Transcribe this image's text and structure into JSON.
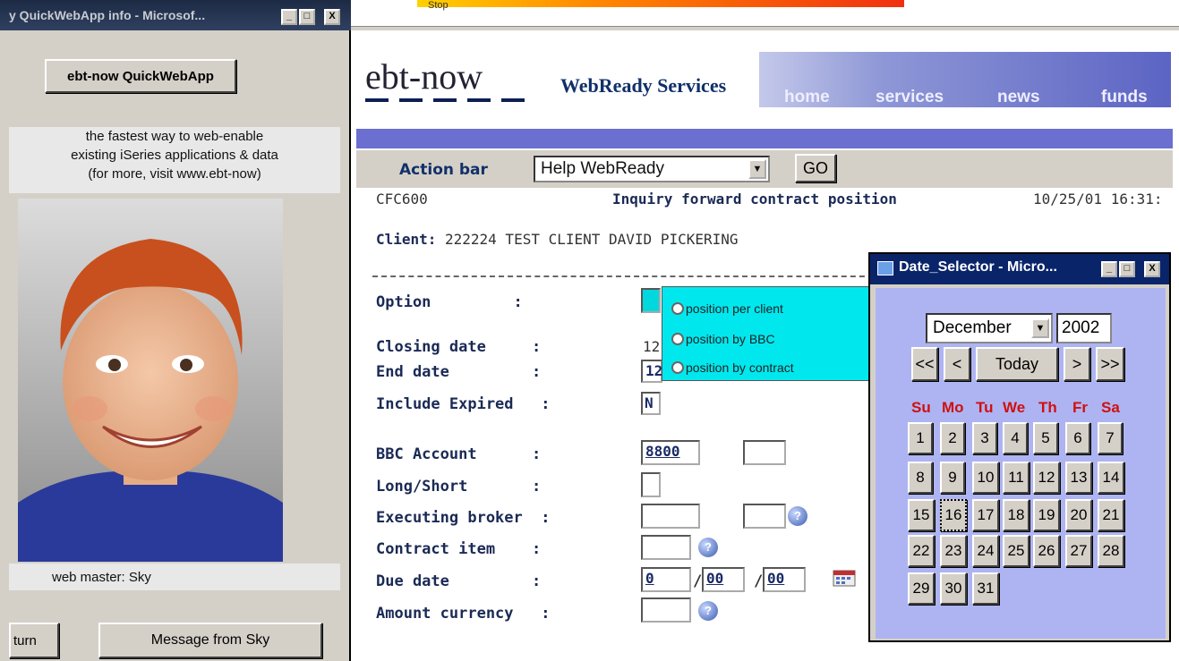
{
  "left_window": {
    "title": "y QuickWebApp info - Microsof...",
    "min": "_",
    "max": "□",
    "close": "X",
    "app_button": "ebt-now QuickWebApp",
    "description": [
      "the fastest way to web-enable",
      "existing iSeries applications & data",
      "(for more, visit www.ebt-now)"
    ],
    "webmaster": "web master: Sky",
    "return_button": "turn",
    "message_button": "Message from Sky"
  },
  "top_strip": {
    "stop": "Stop"
  },
  "header": {
    "logo": "ebt-now",
    "tagline": "WebReady Services",
    "nav": [
      "home",
      "services",
      "news",
      "funds"
    ]
  },
  "action_bar": {
    "label": "Action bar",
    "selected": "Help WebReady",
    "go": "GO"
  },
  "screen": {
    "program": "CFC600",
    "title": "Inquiry forward contract position",
    "datetime": "10/25/01 16:31:",
    "client_label": "Client:",
    "client_value": "222224 TEST CLIENT DAVID PICKERING"
  },
  "fields": {
    "option": "Option         :",
    "closing_date": "Closing date     :",
    "closing_value": "12",
    "end_date": "End date         :",
    "end_value": "12",
    "include_expired": "Include Expired   :",
    "include_value": "N",
    "bbc_account": "BBC Account      :",
    "bbc_value": "8800",
    "long_short": "Long/Short       :",
    "executing_broker": "Executing broker  :",
    "contract_item": "Contract item    :",
    "due_date": "Due date         :",
    "due_d": "0",
    "due_sep1": "/",
    "due_m": "00",
    "due_sep2": "/",
    "due_y": "00",
    "amount_currency": "Amount currency   :"
  },
  "option_popup": [
    "position per client",
    "position by BBC",
    "position by contract"
  ],
  "date_selector": {
    "title": "Date_Selector - Micro...",
    "min": "_",
    "max": "□",
    "close": "X",
    "month": "December",
    "year": "2002",
    "nav": [
      "<<",
      "<",
      "Today",
      ">",
      ">>"
    ],
    "weekdays": [
      "Su",
      "Mo",
      "Tu",
      "We",
      "Th",
      "Fr",
      "Sa"
    ],
    "days": [
      "1",
      "2",
      "3",
      "4",
      "5",
      "6",
      "7",
      "8",
      "9",
      "10",
      "11",
      "12",
      "13",
      "14",
      "15",
      "16",
      "17",
      "18",
      "19",
      "20",
      "21",
      "22",
      "23",
      "24",
      "25",
      "26",
      "27",
      "28",
      "29",
      "30",
      "31"
    ],
    "today": "16"
  },
  "colors": {
    "accent_blue": "#6a6fd0",
    "popup_cyan": "#00e8ee",
    "calendar_bg": "#aeb4f2",
    "weekday_red": "#d01010"
  },
  "icons": [
    "help-icon",
    "calendar-icon"
  ]
}
